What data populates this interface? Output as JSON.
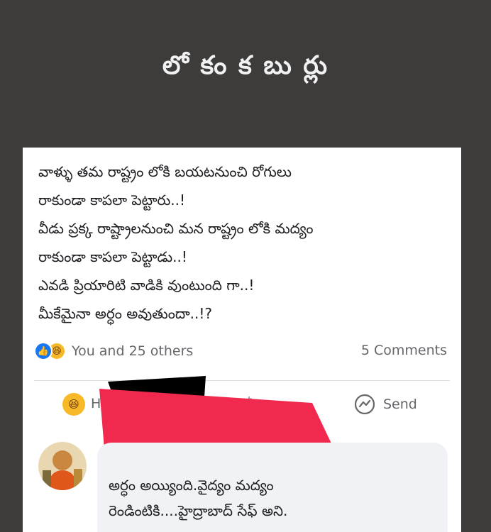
{
  "header": {
    "title": "లో కం  క బు ర్లు"
  },
  "post": {
    "lines": [
      "వాళ్ళు తమ రాష్ట్రం లోకి బయటనుంచి రోగులు",
      "రాకుండా కాపలా పెట్టారు..!",
      "వీడు ప్రక్క రాష్ట్రాలనుంచి మన రాష్ట్రం లోకి మద్యం",
      "రాకుండా కాపలా పెట్టాడు..!",
      "ఎవడి ప్రియారిటి వాడికి వుంటుంది గా..!",
      "మీకేమైనా అర్ధం అవుతుందా..!?"
    ],
    "reactions_text": "You and 25 others",
    "comments_count": "5 Comments",
    "like_glyph": "👍",
    "haha_glyph": "😆"
  },
  "actions": {
    "react_partial": "H",
    "comment_partial": "Comment",
    "send_label": "Send"
  },
  "comment": {
    "lines": [
      "అర్ధం అయ్యింది.వైద్యం మద్యం",
      "రెండింటికి....హైద్రాబాద్  సేఫ్ అని."
    ]
  },
  "icons": {
    "like": "like-icon",
    "haha": "haha-reaction-icon",
    "send": "messenger-icon",
    "avatar": "avatar"
  },
  "colors": {
    "background": "#3e3b3b",
    "card": "#ffffff",
    "facebook_blue": "#1877f2",
    "haha_yellow": "#f7b928",
    "redaction_pink": "#f2294e",
    "redaction_black": "#000000",
    "secondary_text": "#65676b",
    "bubble": "#f0f2f5"
  }
}
